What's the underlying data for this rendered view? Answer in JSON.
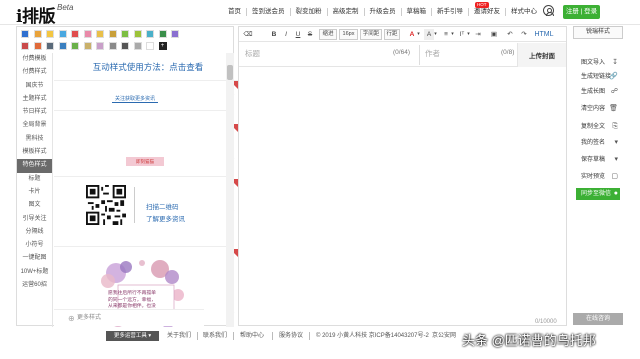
{
  "header": {
    "logo_text": "i排版",
    "logo_beta": "Beta",
    "nav": [
      "首页",
      "签到送会员",
      "裂变加粉",
      "高级定制",
      "升级会员",
      "草稿箱",
      "新手引导",
      "邀请好友",
      "样式中心"
    ],
    "hot_badge": "HOT",
    "login_label": "注册",
    "signup_label": "登录"
  },
  "colors": {
    "accent_green": "#3cb034",
    "link_blue": "#2a6ab0",
    "active_category": "#6a6a6a",
    "swatches_row1": [
      "#2f6fcf",
      "#e9a33b",
      "#f3c642",
      "#4aa8e0",
      "#e04e4e",
      "#e98aa9",
      "#e9c04a",
      "#c9a03a",
      "#7dbe43",
      "#9dc33a",
      "#4ab0c9",
      "#3a8e4a",
      "#8a6fd0"
    ],
    "swatches_row2": [
      "#c94a4a",
      "#e06a3a",
      "#5a6a7a",
      "#3a7fbf",
      "#6ab04a",
      "#c9b06a",
      "#c9a0c9",
      "#8a8a8a",
      "#555555",
      "#aaaaaa",
      "#ffffff",
      "#222222"
    ]
  },
  "categories": [
    "付费模板",
    "付费样式",
    "国庆节",
    "主题样式",
    "节日样式",
    "全局背景",
    "黑科技",
    "模板样式",
    "特色样式",
    "标题",
    "卡片",
    "图文",
    "引导关注",
    "分隔线",
    "小符号",
    "一键配图",
    "10W+标题",
    "运营60招"
  ],
  "active_category": "特色样式",
  "style_panel": {
    "header": "互动样式使用方法：点击查看",
    "card1_text": "关注获取更多资讯",
    "card2_button": "即刻猫猫",
    "qr_line1": "扫描二维码",
    "qr_line2": "了解更多资讯",
    "flower_text": "愿我往后所行不再孤单的同一个远方，幸福，从来都是你相伴。也没有说离无期，只有你和我，只有我在。",
    "more_styles": "更多样式"
  },
  "editor": {
    "toolbar": {
      "eraser": "⌫",
      "bold": "B",
      "italic": "I",
      "underline": "U",
      "strike": "S",
      "bracket": "⌐",
      "format": "缩进",
      "font_size": "16px",
      "letter_spacing": "字间距",
      "line_height": "行距",
      "font_color": "A",
      "bg_color": "A",
      "align": "≡",
      "line_spacing": "Iᵀ",
      "indent": "⇥",
      "image": "▣",
      "undo": "↶",
      "redo": "↷",
      "html": "HTML"
    },
    "title_placeholder": "标题",
    "title_count": "(0/64)",
    "author_placeholder": "作者",
    "author_count": "(0/8)",
    "upload_cover": "上传封面",
    "word_count": "0/10000"
  },
  "right_panel": {
    "smart_layout": "锐瑞样式",
    "buttons": [
      {
        "label": "图文导入",
        "icon": "↧"
      },
      {
        "label": "生成短链接",
        "icon": "🔗"
      },
      {
        "label": "生成长图",
        "icon": "☍"
      },
      {
        "label": "清空内容",
        "icon": "🗑"
      },
      {
        "label": "复制全文",
        "icon": "⎘"
      },
      {
        "label": "我的签名",
        "icon": "▾"
      },
      {
        "label": "保存草稿",
        "icon": "▾"
      },
      {
        "label": "实时预览",
        "icon": "▢"
      },
      {
        "label": "同步至微信",
        "icon": "●"
      }
    ],
    "online_consult": "在线咨询"
  },
  "footer": {
    "tools": "更多运营工具 ▾",
    "links": [
      "关于我们",
      "联系我们",
      "帮助中心",
      "服务协议"
    ],
    "copyright": "© 2019 小黄人科技  京ICP备14043207号-2",
    "police": "京公安网"
  },
  "watermark": "头条 @匹诺曹的乌托邦"
}
